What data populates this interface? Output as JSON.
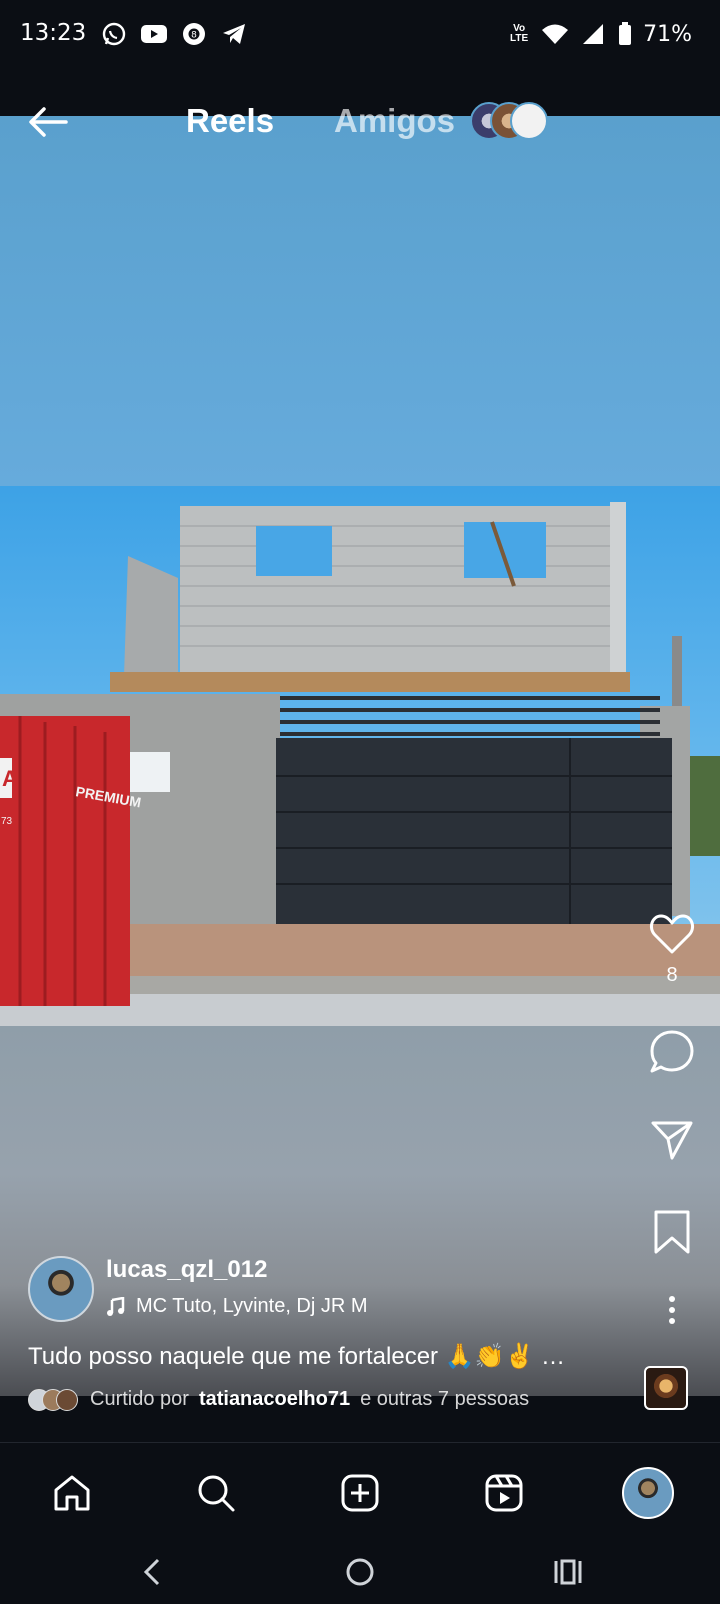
{
  "status_bar": {
    "time": "13:23",
    "left_icons": [
      "whatsapp-icon",
      "youtube-icon",
      "8-ball-icon",
      "telegram-icon"
    ],
    "right_icons": [
      "volte-icon",
      "wifi-icon",
      "signal-icon",
      "battery-icon"
    ],
    "volte_label": "Vo LTE",
    "battery": "71%"
  },
  "header": {
    "tab_reels": "Reels",
    "tab_amigos": "Amigos"
  },
  "actions": {
    "like_count": "8"
  },
  "post": {
    "username": "lucas_qzl_012",
    "music": "MC Tuto, Lyvinte, Dj JR M",
    "caption": "Tudo posso naquele que me fortalecer 🙏👏✌ …",
    "liked_prefix": "Curtido por",
    "liked_user": "tatianacoelho71",
    "liked_suffix": "e outras 7 pessoas"
  },
  "container": {
    "label": "PREMIUM",
    "sign": "A",
    "number": "73"
  },
  "colors": {
    "background": "#0b0e14",
    "accent_white": "#ffffff",
    "container_red": "#c8282c",
    "gate_dark": "#2a3038"
  }
}
